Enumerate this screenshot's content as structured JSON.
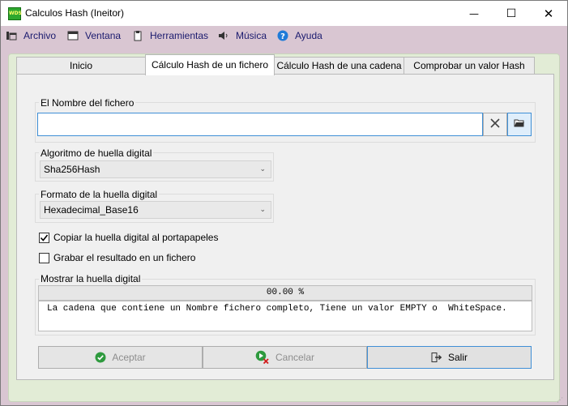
{
  "window": {
    "app_icon_text": "WDS",
    "title": "Calculos Hash (Ineitor)",
    "minimize_glyph": "—",
    "maximize_glyph": "☐",
    "close_glyph": "✕"
  },
  "menu": {
    "items": [
      {
        "label": "Archivo",
        "icon": "file-menu-icon"
      },
      {
        "label": "Ventana",
        "icon": "window-icon"
      },
      {
        "label": "Herramientas",
        "icon": "tools-icon"
      },
      {
        "label": "Música",
        "icon": "speaker-icon"
      },
      {
        "label": "Ayuda",
        "icon": "help-icon"
      }
    ]
  },
  "tabs": [
    {
      "label": "Inicio",
      "active": false
    },
    {
      "label": "Cálculo Hash de un fichero",
      "active": true
    },
    {
      "label": "Cálculo Hash de una cadena",
      "active": false
    },
    {
      "label": "Comprobar un valor Hash",
      "active": false
    }
  ],
  "file_group": {
    "label": "El Nombre del fichero",
    "value": "",
    "clear_icon": "clear-icon",
    "browse_icon": "folder-open-icon"
  },
  "algorithm": {
    "label": "Algoritmo de huella digital",
    "selected": "Sha256Hash"
  },
  "format": {
    "label": "Formato de la huella digital",
    "selected": "Hexadecimal_Base16"
  },
  "options": {
    "copy_to_clipboard": {
      "label": "Copiar la huella digital al portapapeles",
      "checked": true
    },
    "save_to_file": {
      "label": "Grabar el resultado en un fichero",
      "checked": false
    }
  },
  "output": {
    "label": "Mostrar la huella digital",
    "progress_text": "00.00 %",
    "progress_value": 0,
    "message": "La cadena que contiene un Nombre fichero completo, Tiene un valor EMPTY o  WhiteSpace."
  },
  "buttons": {
    "accept": {
      "label": "Aceptar",
      "enabled": false
    },
    "cancel": {
      "label": "Cancelar",
      "enabled": false
    },
    "exit": {
      "label": "Salir",
      "enabled": true
    }
  },
  "colors": {
    "menubar": "#d9c6d2",
    "panel": "#e2ecd6",
    "accent": "#3f8fd6",
    "ok_green": "#2e9a3e",
    "cancel_red": "#d11b1b"
  }
}
